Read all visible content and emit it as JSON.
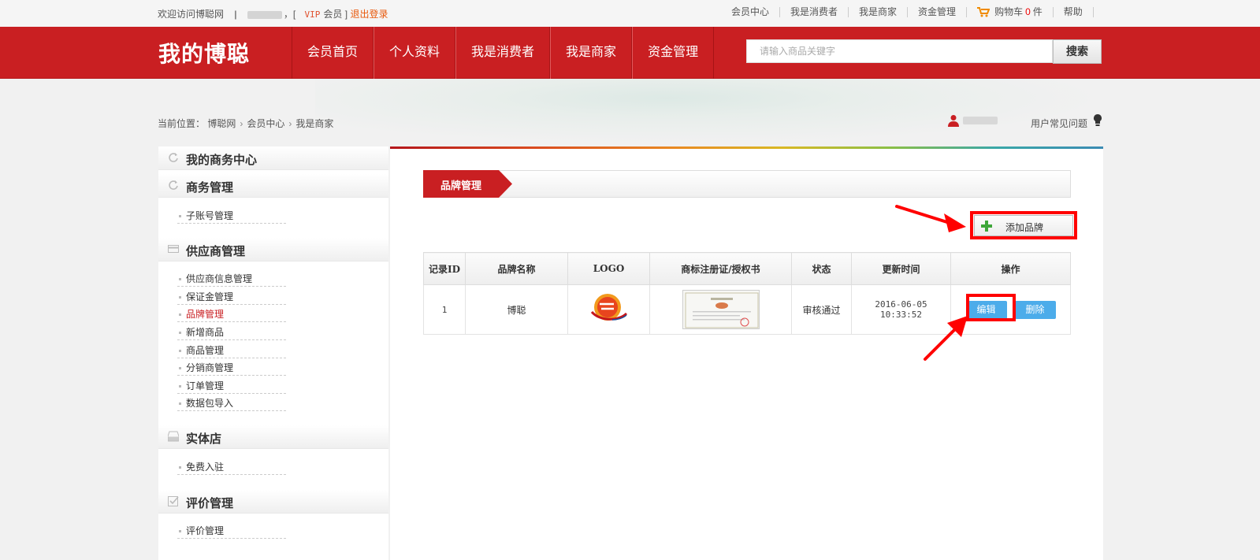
{
  "topbar": {
    "welcome": "欢迎访问博聪网",
    "divider": "|",
    "member_sep": "，[",
    "vip": "VIP",
    "member": "会员",
    "bracket_close": "]",
    "logout": "退出登录",
    "links": [
      "会员中心",
      "我是消费者",
      "我是商家",
      "资金管理"
    ],
    "cart_label": "购物车",
    "cart_count": "0",
    "cart_unit": "件",
    "help": "帮助"
  },
  "header": {
    "logo": "我的博聪",
    "nav": [
      "会员首页",
      "个人资料",
      "我是消费者",
      "我是商家",
      "资金管理"
    ],
    "search_placeholder": "请输入商品关键字",
    "search_button": "搜索"
  },
  "breadcrumb": {
    "prefix": "当前位置：",
    "items": [
      "博聪网",
      "会员中心",
      "我是商家"
    ],
    "arrow": "›"
  },
  "faq": "用户常见问题",
  "sidebar": {
    "sections": [
      {
        "title": "我的商务中心",
        "items": []
      },
      {
        "title": "商务管理",
        "items": [
          "子账号管理"
        ]
      },
      {
        "title": "供应商管理",
        "items": [
          "供应商信息管理",
          "保证金管理",
          "品牌管理",
          "新增商品",
          "商品管理",
          "分销商管理",
          "订单管理",
          "数据包导入"
        ]
      },
      {
        "title": "实体店",
        "items": [
          "免费入驻"
        ]
      },
      {
        "title": "评价管理",
        "items": [
          "评价管理"
        ]
      }
    ]
  },
  "main": {
    "title": "品牌管理",
    "add_button": "添加品牌",
    "table": {
      "headers": [
        "记录ID",
        "品牌名称",
        "LOGO",
        "商标注册证/授权书",
        "状态",
        "更新时间",
        "操作"
      ],
      "rows": [
        {
          "id": "1",
          "name": "博聪",
          "status": "审核通过",
          "updated": "2016-06-05 10:33:52",
          "edit": "编辑",
          "delete": "删除"
        }
      ]
    }
  },
  "colors": {
    "brand_red": "#c91f22",
    "button_blue": "#4cacea",
    "highlight": "#ff0000"
  }
}
